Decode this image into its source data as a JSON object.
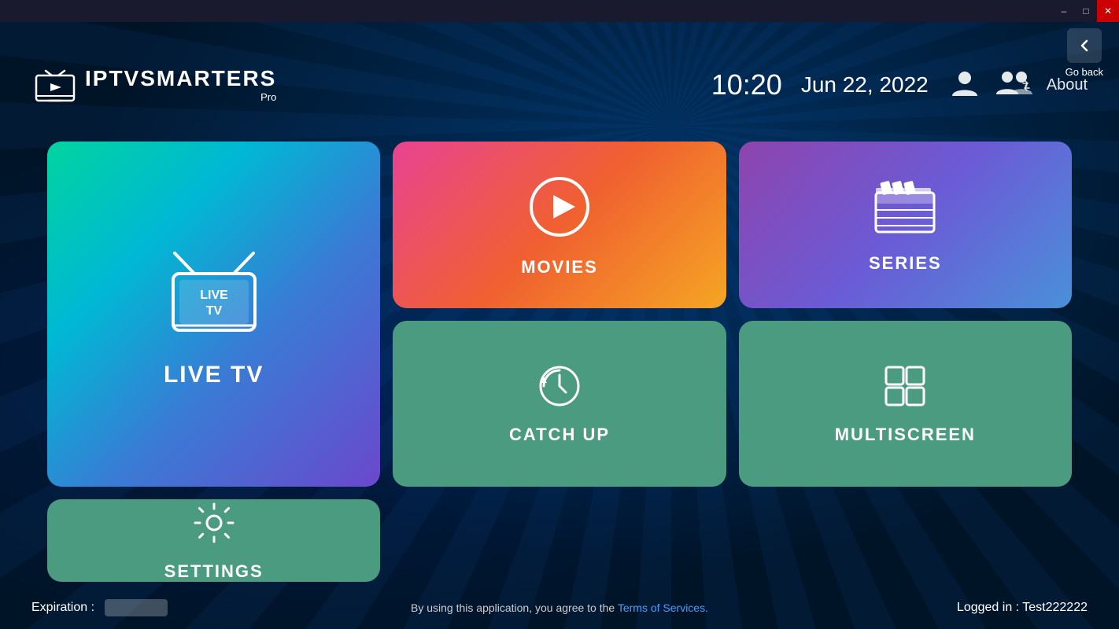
{
  "titlebar": {
    "minimize_label": "–",
    "maximize_label": "□",
    "close_label": "✕"
  },
  "header": {
    "logo_iptv": "IPTV",
    "logo_smarters": "SMARTERS",
    "logo_pro": "Pro",
    "time": "10:20",
    "date": "Jun 22, 2022",
    "about_label": "About",
    "go_back_label": "Go back"
  },
  "cards": {
    "live_tv": {
      "label": "LIVE TV",
      "sublabel": "LIVE\nTV"
    },
    "movies": {
      "label": "MOVIES"
    },
    "series": {
      "label": "SERIES"
    },
    "catch_up": {
      "label": "CATCH UP"
    },
    "multiscreen": {
      "label": "MULTISCREEN"
    },
    "settings": {
      "label": "SETTINGS"
    }
  },
  "footer": {
    "expiration_label": "Expiration :",
    "terms_text": "By using this application, you agree to the ",
    "terms_link": "Terms of Services.",
    "logged_in": "Logged in : Test222222"
  }
}
